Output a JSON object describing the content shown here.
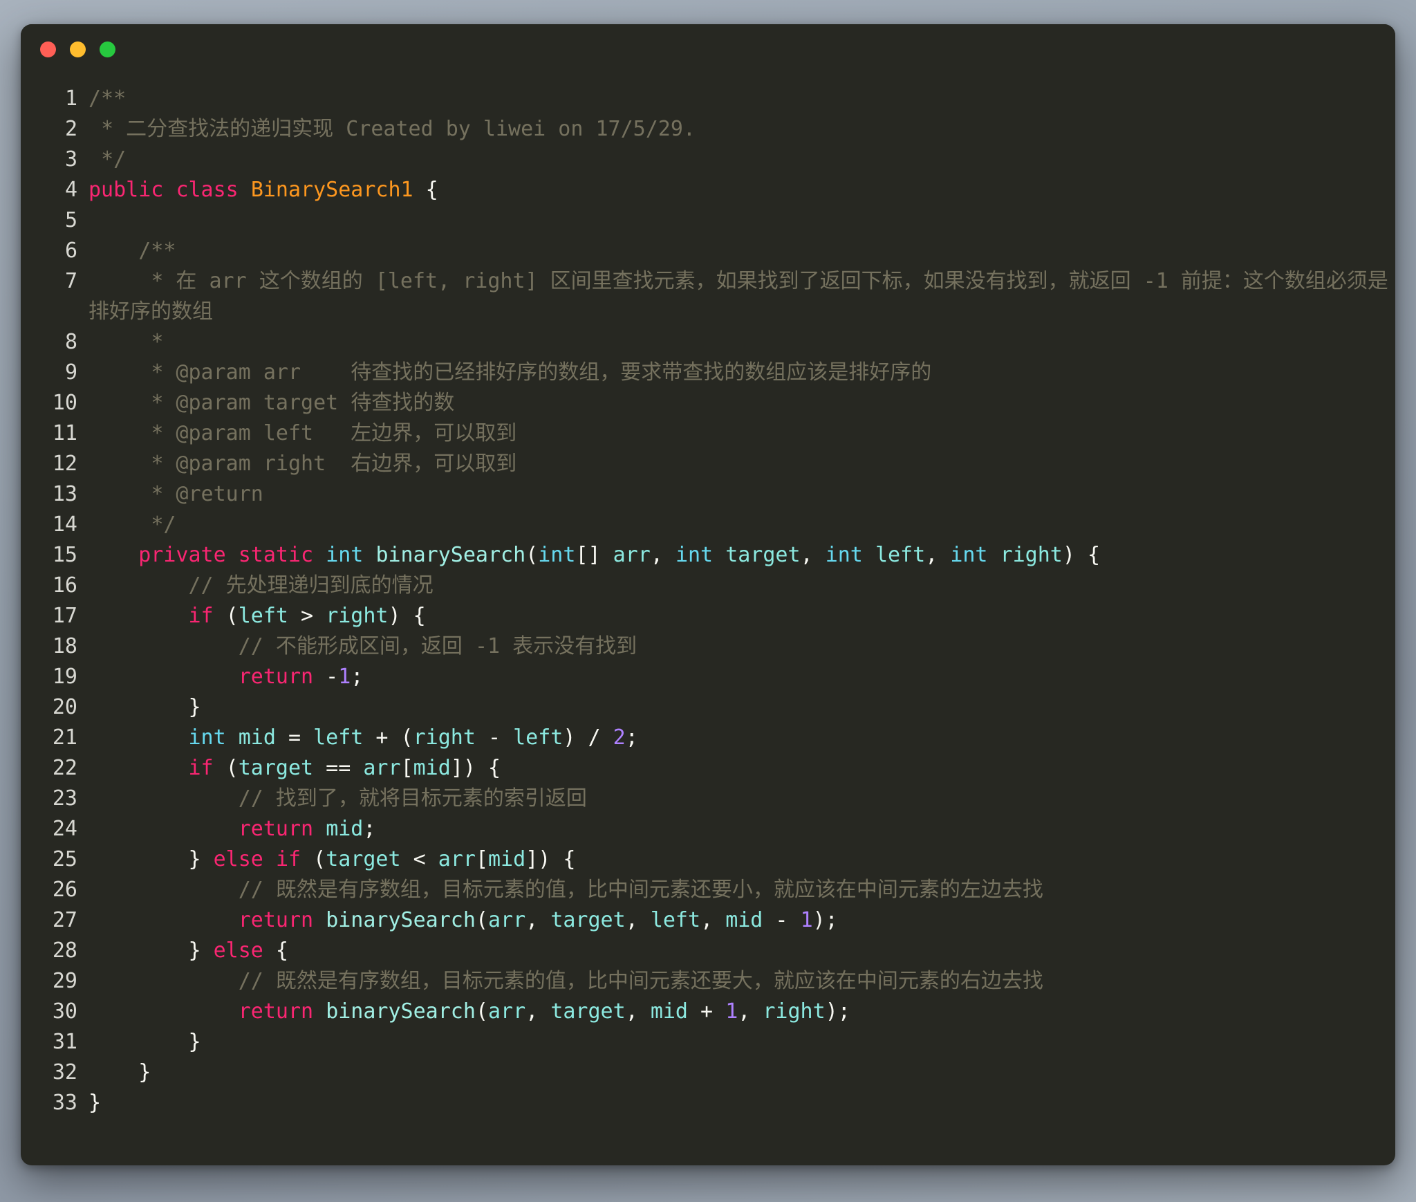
{
  "window": {
    "title_bar": {
      "buttons": [
        {
          "name": "close",
          "label": "",
          "color": "#ff5f56"
        },
        {
          "name": "minimize",
          "label": "",
          "color": "#ffbd2e"
        },
        {
          "name": "zoom",
          "label": "",
          "color": "#27c93f"
        }
      ]
    },
    "background": "#272822"
  },
  "theme": {
    "name": "monokai",
    "background": "#272822",
    "foreground": "#f8f8f2",
    "comment": "#75715e",
    "keyword": "#f92672",
    "type": "#66d9ef",
    "class_name": "#fd971f",
    "function": "#a1efe4",
    "variable": "#8ce9e0",
    "number": "#ae81ff",
    "gutter": "#d8d8d2"
  },
  "code": {
    "language": "java",
    "lines": [
      {
        "number": "1",
        "tokens": [
          {
            "t": "comment",
            "s": "/**"
          }
        ]
      },
      {
        "number": "2",
        "tokens": [
          {
            "t": "comment",
            "s": " * 二分查找法的递归实现 Created by liwei on 17/5/29."
          }
        ]
      },
      {
        "number": "3",
        "tokens": [
          {
            "t": "comment",
            "s": " */"
          }
        ]
      },
      {
        "number": "4",
        "tokens": [
          {
            "t": "keyword",
            "s": "public"
          },
          {
            "t": "plain",
            "s": " "
          },
          {
            "t": "keyword",
            "s": "class"
          },
          {
            "t": "plain",
            "s": " "
          },
          {
            "t": "class",
            "s": "BinarySearch1"
          },
          {
            "t": "plain",
            "s": " {"
          }
        ]
      },
      {
        "number": "5",
        "tokens": [
          {
            "t": "plain",
            "s": ""
          }
        ]
      },
      {
        "number": "6",
        "tokens": [
          {
            "t": "comment",
            "s": "    /**"
          }
        ]
      },
      {
        "number": "7",
        "tokens": [
          {
            "t": "comment",
            "s": "     * 在 arr 这个数组的 [left, right] 区间里查找元素，如果找到了返回下标，如果没有找到，就返回 -1 前提：这个数组必须是排好序的数组"
          }
        ]
      },
      {
        "number": "8",
        "tokens": [
          {
            "t": "comment",
            "s": "     *"
          }
        ]
      },
      {
        "number": "9",
        "tokens": [
          {
            "t": "comment",
            "s": "     * @param arr    待查找的已经排好序的数组，要求带查找的数组应该是排好序的"
          }
        ]
      },
      {
        "number": "10",
        "tokens": [
          {
            "t": "comment",
            "s": "     * @param target 待查找的数"
          }
        ]
      },
      {
        "number": "11",
        "tokens": [
          {
            "t": "comment",
            "s": "     * @param left   左边界，可以取到"
          }
        ]
      },
      {
        "number": "12",
        "tokens": [
          {
            "t": "comment",
            "s": "     * @param right  右边界，可以取到"
          }
        ]
      },
      {
        "number": "13",
        "tokens": [
          {
            "t": "comment",
            "s": "     * @return"
          }
        ]
      },
      {
        "number": "14",
        "tokens": [
          {
            "t": "comment",
            "s": "     */"
          }
        ]
      },
      {
        "number": "15",
        "tokens": [
          {
            "t": "plain",
            "s": "    "
          },
          {
            "t": "keyword",
            "s": "private"
          },
          {
            "t": "plain",
            "s": " "
          },
          {
            "t": "keyword",
            "s": "static"
          },
          {
            "t": "plain",
            "s": " "
          },
          {
            "t": "type",
            "s": "int"
          },
          {
            "t": "plain",
            "s": " "
          },
          {
            "t": "func",
            "s": "binarySearch"
          },
          {
            "t": "punct",
            "s": "("
          },
          {
            "t": "type",
            "s": "int"
          },
          {
            "t": "punct",
            "s": "[] "
          },
          {
            "t": "var",
            "s": "arr"
          },
          {
            "t": "punct",
            "s": ", "
          },
          {
            "t": "type",
            "s": "int"
          },
          {
            "t": "plain",
            "s": " "
          },
          {
            "t": "var",
            "s": "target"
          },
          {
            "t": "punct",
            "s": ", "
          },
          {
            "t": "type",
            "s": "int"
          },
          {
            "t": "plain",
            "s": " "
          },
          {
            "t": "var",
            "s": "left"
          },
          {
            "t": "punct",
            "s": ", "
          },
          {
            "t": "type",
            "s": "int"
          },
          {
            "t": "plain",
            "s": " "
          },
          {
            "t": "var",
            "s": "right"
          },
          {
            "t": "punct",
            "s": ") {"
          }
        ]
      },
      {
        "number": "16",
        "tokens": [
          {
            "t": "comment",
            "s": "        // 先处理递归到底的情况"
          }
        ]
      },
      {
        "number": "17",
        "tokens": [
          {
            "t": "plain",
            "s": "        "
          },
          {
            "t": "keyword",
            "s": "if"
          },
          {
            "t": "punct",
            "s": " ("
          },
          {
            "t": "var",
            "s": "left"
          },
          {
            "t": "punct",
            "s": " > "
          },
          {
            "t": "var",
            "s": "right"
          },
          {
            "t": "punct",
            "s": ") {"
          }
        ]
      },
      {
        "number": "18",
        "tokens": [
          {
            "t": "comment",
            "s": "            // 不能形成区间，返回 -1 表示没有找到"
          }
        ]
      },
      {
        "number": "19",
        "tokens": [
          {
            "t": "plain",
            "s": "            "
          },
          {
            "t": "keyword",
            "s": "return"
          },
          {
            "t": "punct",
            "s": " -"
          },
          {
            "t": "number",
            "s": "1"
          },
          {
            "t": "punct",
            "s": ";"
          }
        ]
      },
      {
        "number": "20",
        "tokens": [
          {
            "t": "punct",
            "s": "        }"
          }
        ]
      },
      {
        "number": "21",
        "tokens": [
          {
            "t": "plain",
            "s": "        "
          },
          {
            "t": "type",
            "s": "int"
          },
          {
            "t": "plain",
            "s": " "
          },
          {
            "t": "var",
            "s": "mid"
          },
          {
            "t": "punct",
            "s": " = "
          },
          {
            "t": "var",
            "s": "left"
          },
          {
            "t": "punct",
            "s": " + ("
          },
          {
            "t": "var",
            "s": "right"
          },
          {
            "t": "punct",
            "s": " - "
          },
          {
            "t": "var",
            "s": "left"
          },
          {
            "t": "punct",
            "s": ") / "
          },
          {
            "t": "number",
            "s": "2"
          },
          {
            "t": "punct",
            "s": ";"
          }
        ]
      },
      {
        "number": "22",
        "tokens": [
          {
            "t": "plain",
            "s": "        "
          },
          {
            "t": "keyword",
            "s": "if"
          },
          {
            "t": "punct",
            "s": " ("
          },
          {
            "t": "var",
            "s": "target"
          },
          {
            "t": "punct",
            "s": " == "
          },
          {
            "t": "var",
            "s": "arr"
          },
          {
            "t": "punct",
            "s": "["
          },
          {
            "t": "var",
            "s": "mid"
          },
          {
            "t": "punct",
            "s": "]) {"
          }
        ]
      },
      {
        "number": "23",
        "tokens": [
          {
            "t": "comment",
            "s": "            // 找到了，就将目标元素的索引返回"
          }
        ]
      },
      {
        "number": "24",
        "tokens": [
          {
            "t": "plain",
            "s": "            "
          },
          {
            "t": "keyword",
            "s": "return"
          },
          {
            "t": "plain",
            "s": " "
          },
          {
            "t": "var",
            "s": "mid"
          },
          {
            "t": "punct",
            "s": ";"
          }
        ]
      },
      {
        "number": "25",
        "tokens": [
          {
            "t": "punct",
            "s": "        } "
          },
          {
            "t": "keyword",
            "s": "else"
          },
          {
            "t": "plain",
            "s": " "
          },
          {
            "t": "keyword",
            "s": "if"
          },
          {
            "t": "punct",
            "s": " ("
          },
          {
            "t": "var",
            "s": "target"
          },
          {
            "t": "punct",
            "s": " < "
          },
          {
            "t": "var",
            "s": "arr"
          },
          {
            "t": "punct",
            "s": "["
          },
          {
            "t": "var",
            "s": "mid"
          },
          {
            "t": "punct",
            "s": "]) {"
          }
        ]
      },
      {
        "number": "26",
        "tokens": [
          {
            "t": "comment",
            "s": "            // 既然是有序数组，目标元素的值，比中间元素还要小，就应该在中间元素的左边去找"
          }
        ]
      },
      {
        "number": "27",
        "tokens": [
          {
            "t": "plain",
            "s": "            "
          },
          {
            "t": "keyword",
            "s": "return"
          },
          {
            "t": "plain",
            "s": " "
          },
          {
            "t": "func",
            "s": "binarySearch"
          },
          {
            "t": "punct",
            "s": "("
          },
          {
            "t": "var",
            "s": "arr"
          },
          {
            "t": "punct",
            "s": ", "
          },
          {
            "t": "var",
            "s": "target"
          },
          {
            "t": "punct",
            "s": ", "
          },
          {
            "t": "var",
            "s": "left"
          },
          {
            "t": "punct",
            "s": ", "
          },
          {
            "t": "var",
            "s": "mid"
          },
          {
            "t": "punct",
            "s": " - "
          },
          {
            "t": "number",
            "s": "1"
          },
          {
            "t": "punct",
            "s": ");"
          }
        ]
      },
      {
        "number": "28",
        "tokens": [
          {
            "t": "punct",
            "s": "        } "
          },
          {
            "t": "keyword",
            "s": "else"
          },
          {
            "t": "punct",
            "s": " {"
          }
        ]
      },
      {
        "number": "29",
        "tokens": [
          {
            "t": "comment",
            "s": "            // 既然是有序数组，目标元素的值，比中间元素还要大，就应该在中间元素的右边去找"
          }
        ]
      },
      {
        "number": "30",
        "tokens": [
          {
            "t": "plain",
            "s": "            "
          },
          {
            "t": "keyword",
            "s": "return"
          },
          {
            "t": "plain",
            "s": " "
          },
          {
            "t": "func",
            "s": "binarySearch"
          },
          {
            "t": "punct",
            "s": "("
          },
          {
            "t": "var",
            "s": "arr"
          },
          {
            "t": "punct",
            "s": ", "
          },
          {
            "t": "var",
            "s": "target"
          },
          {
            "t": "punct",
            "s": ", "
          },
          {
            "t": "var",
            "s": "mid"
          },
          {
            "t": "punct",
            "s": " + "
          },
          {
            "t": "number",
            "s": "1"
          },
          {
            "t": "punct",
            "s": ", "
          },
          {
            "t": "var",
            "s": "right"
          },
          {
            "t": "punct",
            "s": ");"
          }
        ]
      },
      {
        "number": "31",
        "tokens": [
          {
            "t": "punct",
            "s": "        }"
          }
        ]
      },
      {
        "number": "32",
        "tokens": [
          {
            "t": "punct",
            "s": "    }"
          }
        ]
      },
      {
        "number": "33",
        "tokens": [
          {
            "t": "punct",
            "s": "}"
          }
        ]
      }
    ]
  }
}
